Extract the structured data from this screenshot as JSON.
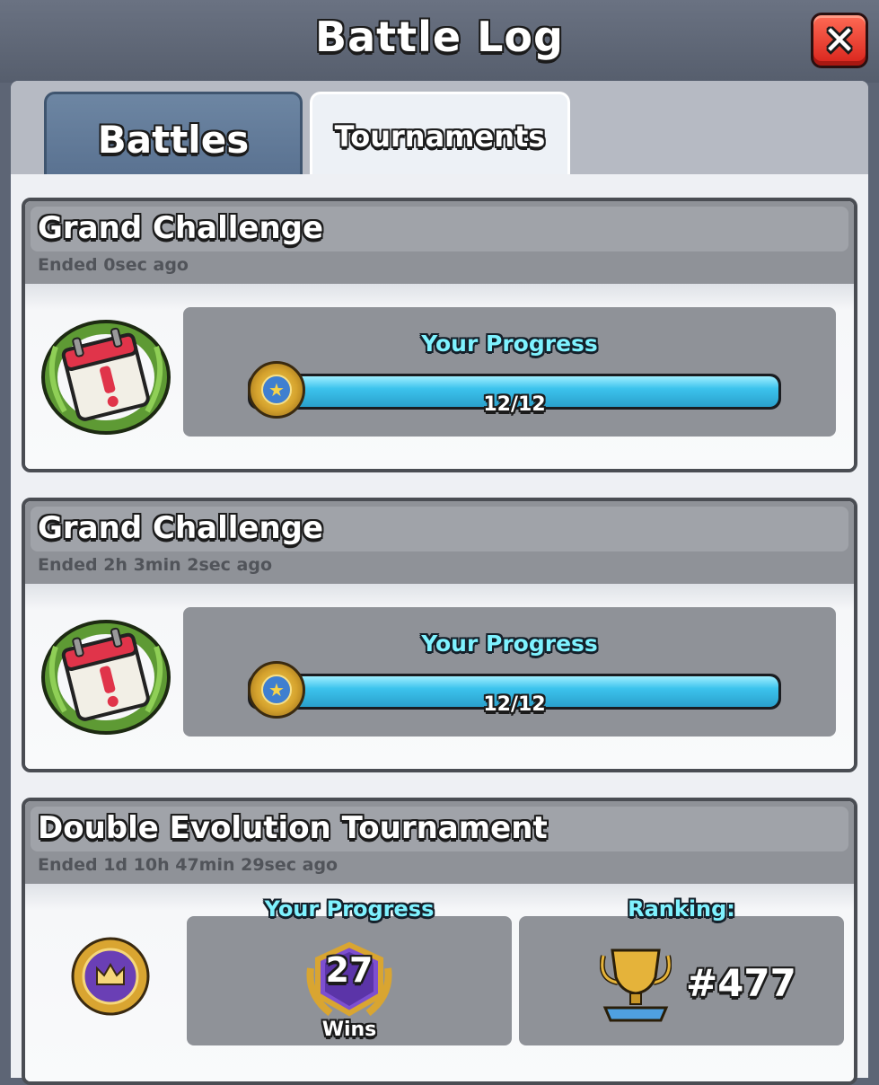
{
  "header": {
    "title": "Battle Log",
    "close_icon": "close-x-icon"
  },
  "tabs": [
    {
      "label": "Battles",
      "active": false
    },
    {
      "label": "Tournaments",
      "active": true
    }
  ],
  "entries": [
    {
      "title": "Grand Challenge",
      "ended": "Ended 0sec ago",
      "icon": "calendar-wreath-icon",
      "progress_label": "Your Progress",
      "progress_value": "12/12",
      "progress_fraction": 1.0
    },
    {
      "title": "Grand Challenge",
      "ended": "Ended 2h 3min  2sec ago",
      "icon": "calendar-wreath-icon",
      "progress_label": "Your Progress",
      "progress_value": "12/12",
      "progress_fraction": 1.0
    },
    {
      "title": "Double Evolution Tournament",
      "ended": "Ended 1d 10h 47min  29sec ago",
      "icon": "crown-badge-icon",
      "progress_label": "Your Progress",
      "wins_count": "27",
      "wins_label": "Wins",
      "ranking_label": "Ranking:",
      "ranking_value": "#477"
    }
  ],
  "colors": {
    "progress_bar": "#3cc3ed",
    "label_cyan": "#7ff2ff",
    "close_button": "#d8231b"
  }
}
